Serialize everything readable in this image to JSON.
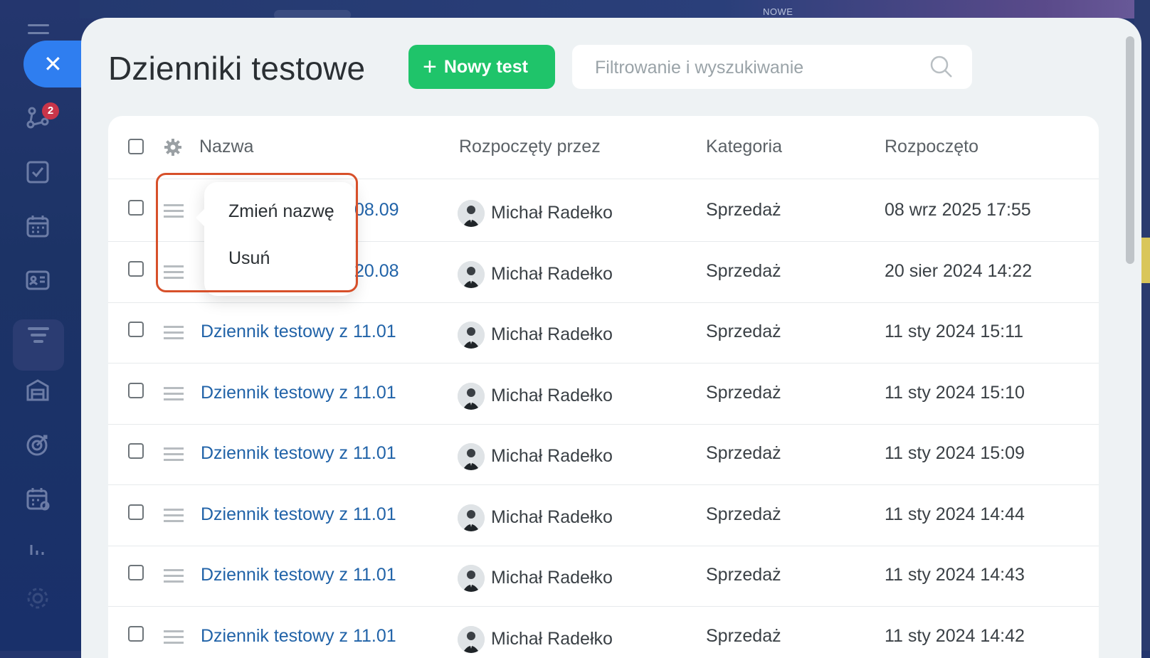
{
  "topbar": {
    "new_label": "NOWE"
  },
  "sidebar": {
    "close_glyph": "✕",
    "notification_count": "2",
    "icons": [
      "menu-icon",
      "close-icon",
      "automation-icon",
      "task-check-icon",
      "calendar-icon",
      "contact-card-icon",
      "funnel-icon",
      "archive-icon",
      "target-icon",
      "schedule-icon",
      "chart-icon",
      "settings-icon"
    ]
  },
  "page": {
    "title": "Dzienniki testowe",
    "new_button_label": "Nowy test",
    "search_placeholder": "Filtrowanie i wyszukiwanie"
  },
  "table": {
    "columns": [
      "Nazwa",
      "Rozpoczęty przez",
      "Kategoria",
      "Rozpoczęto"
    ],
    "rows": [
      {
        "name": "08.09",
        "started_by": "Michał Radełko",
        "category": "Sprzedaż",
        "started": "08 wrz 2025 17:55"
      },
      {
        "name": "20.08",
        "started_by": "Michał Radełko",
        "category": "Sprzedaż",
        "started": "20 sier 2024 14:22"
      },
      {
        "name": "Dziennik testowy z 11.01",
        "started_by": "Michał Radełko",
        "category": "Sprzedaż",
        "started": "11 sty 2024 15:11"
      },
      {
        "name": "Dziennik testowy z 11.01",
        "started_by": "Michał Radełko",
        "category": "Sprzedaż",
        "started": "11 sty 2024 15:10"
      },
      {
        "name": "Dziennik testowy z 11.01",
        "started_by": "Michał Radełko",
        "category": "Sprzedaż",
        "started": "11 sty 2024 15:09"
      },
      {
        "name": "Dziennik testowy z 11.01",
        "started_by": "Michał Radełko",
        "category": "Sprzedaż",
        "started": "11 sty 2024 14:44"
      },
      {
        "name": "Dziennik testowy z 11.01",
        "started_by": "Michał Radełko",
        "category": "Sprzedaż",
        "started": "11 sty 2024 14:43"
      },
      {
        "name": "Dziennik testowy z 11.01",
        "started_by": "Michał Radełko",
        "category": "Sprzedaż",
        "started": "11 sty 2024 14:42"
      }
    ]
  },
  "context_menu": {
    "items": [
      "Zmień nazwę",
      "Usuń"
    ]
  },
  "colors": {
    "accent_green": "#1fc46a",
    "link_blue": "#2163a8",
    "highlight_orange": "#d7502a",
    "close_blue": "#2f7ef0"
  }
}
